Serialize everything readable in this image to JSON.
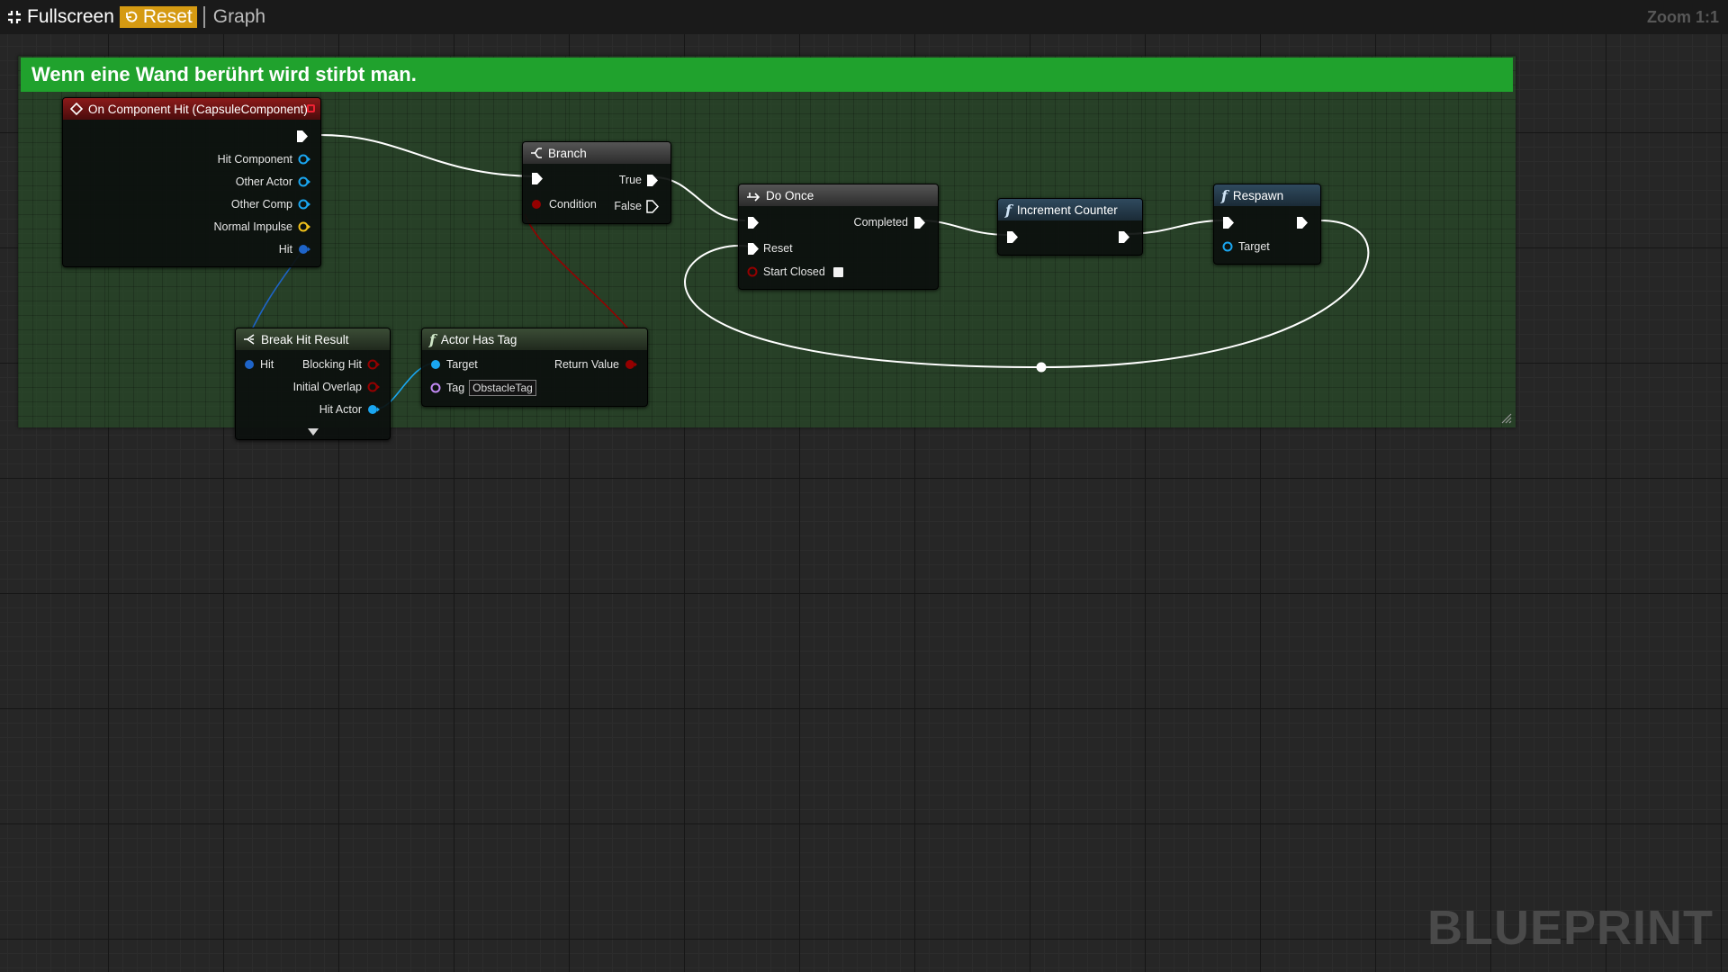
{
  "toolbar": {
    "fullscreen_label": "Fullscreen",
    "reset_label": "Reset",
    "graph_label": "Graph",
    "zoom_label": "Zoom 1:1"
  },
  "comment": {
    "title": "Wenn eine Wand berührt wird stirbt man."
  },
  "nodes": {
    "on_component_hit": {
      "title": "On Component Hit (CapsuleComponent)",
      "pins": {
        "hit_component": "Hit Component",
        "other_actor": "Other Actor",
        "other_comp": "Other Comp",
        "normal_impulse": "Normal Impulse",
        "hit": "Hit"
      }
    },
    "branch": {
      "title": "Branch",
      "pins": {
        "condition": "Condition",
        "true": "True",
        "false": "False"
      }
    },
    "do_once": {
      "title": "Do Once",
      "pins": {
        "completed": "Completed",
        "reset": "Reset",
        "start_closed": "Start Closed"
      },
      "start_closed_checked": false
    },
    "increment_counter": {
      "title": "Increment Counter"
    },
    "respawn": {
      "title": "Respawn",
      "pins": {
        "target": "Target"
      }
    },
    "break_hit_result": {
      "title": "Break Hit Result",
      "pins": {
        "hit": "Hit",
        "blocking_hit": "Blocking Hit",
        "initial_overlap": "Initial Overlap",
        "hit_actor": "Hit Actor"
      }
    },
    "actor_has_tag": {
      "title": "Actor Has Tag",
      "pins": {
        "target": "Target",
        "return_value": "Return Value",
        "tag": "Tag"
      },
      "tag_value": "ObstacleTag"
    }
  },
  "pin_colors": {
    "exec": "#ffffff",
    "object": "#1aa6f0",
    "struct_hit": "#1e64c8",
    "vector": "#f2c21b",
    "bool": "#950000",
    "name": "#c38af5"
  },
  "watermark": "BLUEPRINT"
}
